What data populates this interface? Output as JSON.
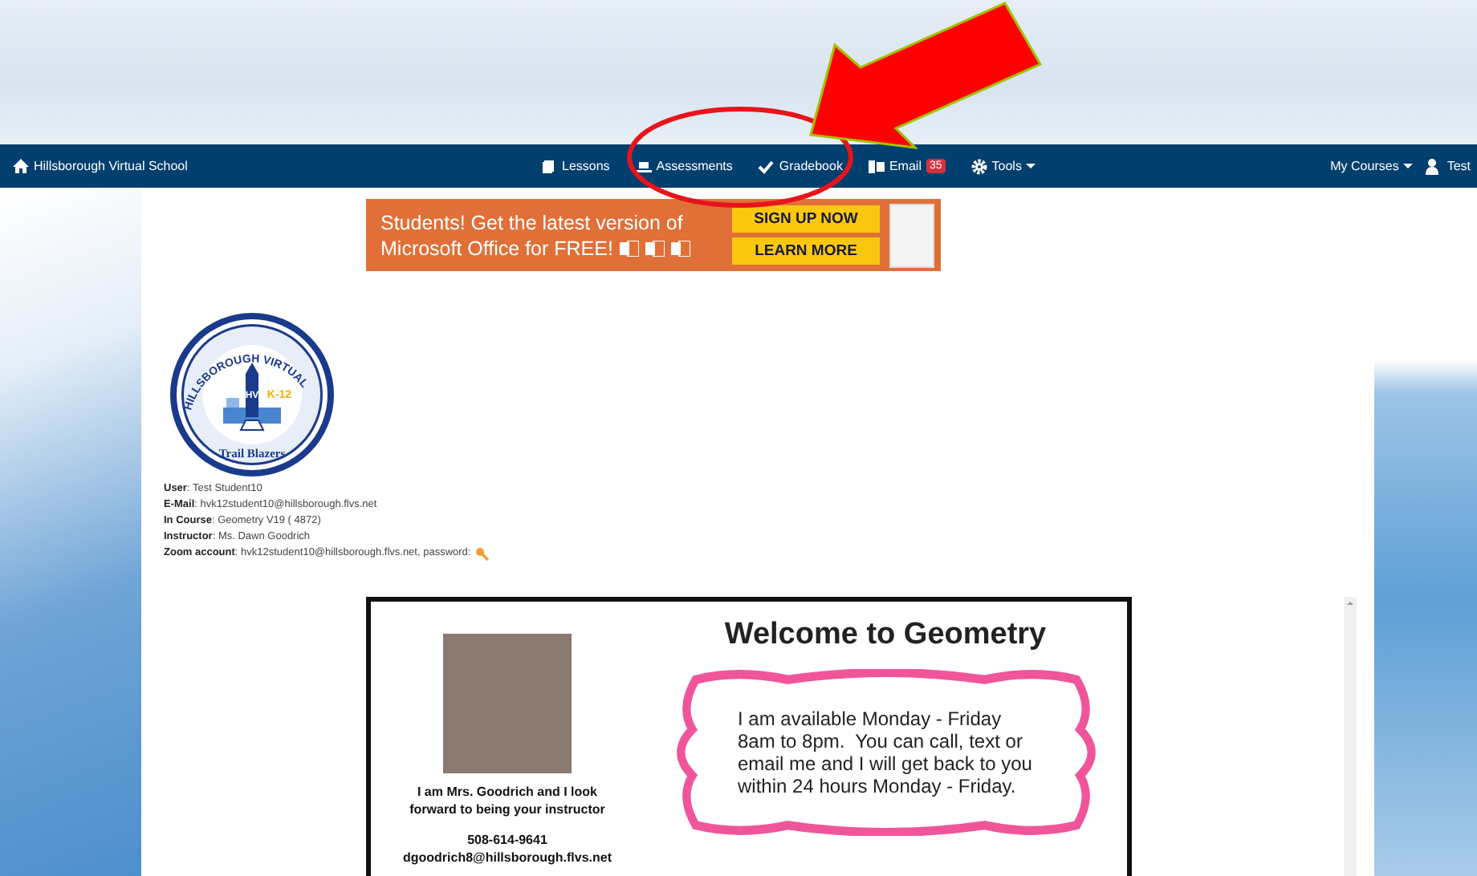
{
  "navbar": {
    "brand": "Hillsborough Virtual School",
    "items": [
      {
        "label": "Lessons",
        "kind": "link"
      },
      {
        "label": "Assessments",
        "kind": "link"
      },
      {
        "label": "Gradebook",
        "kind": "link"
      },
      {
        "label": "Email",
        "kind": "link",
        "badge": "35"
      },
      {
        "label": "Tools",
        "kind": "menu"
      }
    ],
    "right_items": [
      {
        "label": "My Courses",
        "kind": "menu"
      },
      {
        "label": "Test",
        "kind": "link"
      }
    ]
  },
  "banner": {
    "lines": [
      "Students! Get the latest version of",
      "Microsoft Office for FREE!"
    ],
    "buttons": [
      "SIGN UP NOW",
      "LEARN MORE"
    ]
  },
  "logo": {
    "arc_text": "HILLSBOROUGH VIRTUAL",
    "grade": "K-12",
    "initials": "HV",
    "motto": "Trail Blazers"
  },
  "info": [
    "**User**: Test Student10",
    "**E-Mail**: hvk12student10@hillsborough.flvs.net",
    "**In Course**: Geometry V19 ( 4872)",
    "**Instructor**: Ms. Dawn Goodrich",
    "**Zoom account**: hvk12student10@hillsborough.flvs.net, password:"
  ],
  "welcome": {
    "title": "Welcome to Geometry",
    "caption": "I am Mrs. Goodrich and I look forward to being your instructor",
    "phone": "508-614-9641",
    "email": "dgoodrich8@hillsborough.flvs.net",
    "bubble": "I am available Monday - Friday 8am to 8pm.  You can call, text or email me and I will get back to you within 24 hours Monday - Friday."
  }
}
